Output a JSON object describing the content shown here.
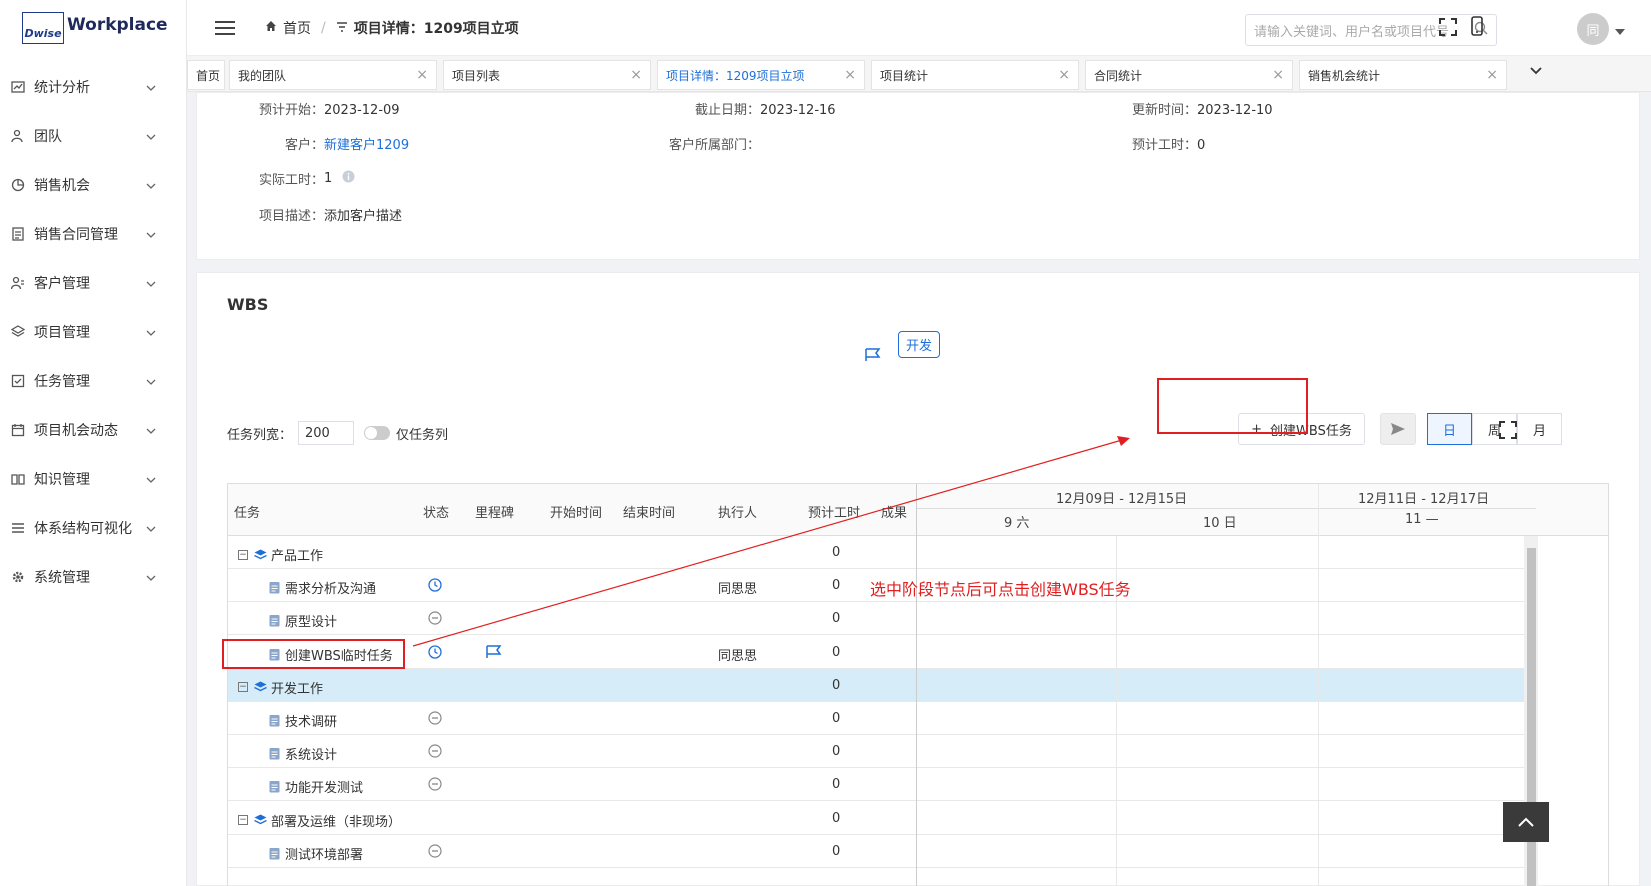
{
  "logo": {
    "mark": "Dwise",
    "text": "Workplace"
  },
  "sidebar": {
    "items": [
      {
        "label": "统计分析",
        "icon": "chart-icon"
      },
      {
        "label": "团队",
        "icon": "team-icon"
      },
      {
        "label": "销售机会",
        "icon": "pie-icon"
      },
      {
        "label": "销售合同管理",
        "icon": "contract-icon"
      },
      {
        "label": "客户管理",
        "icon": "customer-icon"
      },
      {
        "label": "项目管理",
        "icon": "layers-icon"
      },
      {
        "label": "任务管理",
        "icon": "task-icon"
      },
      {
        "label": "项目机会动态",
        "icon": "calendar-icon"
      },
      {
        "label": "知识管理",
        "icon": "book-icon"
      },
      {
        "label": "体系结构可视化",
        "icon": "list-icon"
      },
      {
        "label": "系统管理",
        "icon": "gear-icon"
      }
    ]
  },
  "header": {
    "crumb_home": "首页",
    "crumb_current": "项目详情：1209项目立项",
    "search_placeholder": "请输入关键词、用户名或项目代号",
    "avatar": "同"
  },
  "tabs": [
    {
      "label": "首页"
    },
    {
      "label": "我的团队"
    },
    {
      "label": "项目列表"
    },
    {
      "label": "项目详情：1209项目立项"
    },
    {
      "label": "项目统计"
    },
    {
      "label": "合同统计"
    },
    {
      "label": "销售机会统计"
    }
  ],
  "info": {
    "plan_start_k": "预计开始：",
    "plan_start_v": "2023-12-09",
    "deadline_k": "截止日期：",
    "deadline_v": "2023-12-16",
    "updated_k": "更新时间：",
    "updated_v": "2023-12-10",
    "customer_k": "客户：",
    "customer_v": "新建客户1209",
    "cust_dept_k": "客户所属部门：",
    "est_hours_k": "预计工时：",
    "est_hours_v": "0",
    "actual_hours_k": "实际工时：",
    "actual_hours_v": "1",
    "desc_k": "项目描述：",
    "desc_v": "添加客户描述"
  },
  "wbs": {
    "title": "WBS",
    "milestone": "开发",
    "col_width_label": "任务列宽：",
    "col_width_value": "200",
    "only_tasks": "仅任务列",
    "create_btn": "创建WBS任务",
    "view_day": "日",
    "view_week": "周",
    "view_month": "月",
    "columns": {
      "task": "任务",
      "status": "状态",
      "milestone": "里程碑",
      "start": "开始时间",
      "end": "结束时间",
      "owner": "执行人",
      "est": "预计工时",
      "result": "成果"
    },
    "timeline": {
      "week1": "12月09日 - 12月15日",
      "week2": "12月11日 - 12月17日",
      "d1": "9 六",
      "d2": "10 日",
      "d3": "11 —"
    },
    "rows": [
      {
        "name": "产品工作",
        "level": 0,
        "est": "0"
      },
      {
        "name": "需求分析及沟通",
        "level": 1,
        "status": "clock",
        "owner": "同思思",
        "est": "0"
      },
      {
        "name": "原型设计",
        "level": 1,
        "status": "minus",
        "est": "0"
      },
      {
        "name": "创建WBS临时任务",
        "level": 1,
        "status": "clock",
        "flag": true,
        "owner": "同思思",
        "est": "0"
      },
      {
        "name": "开发工作",
        "level": 0,
        "est": "0",
        "selected": true
      },
      {
        "name": "技术调研",
        "level": 1,
        "status": "minus",
        "est": "0"
      },
      {
        "name": "系统设计",
        "level": 1,
        "status": "minus",
        "est": "0"
      },
      {
        "name": "功能开发测试",
        "level": 1,
        "status": "minus",
        "est": "0"
      },
      {
        "name": "部署及运维（非现场）",
        "level": 0,
        "est": "0"
      },
      {
        "name": "测试环境部署",
        "level": 1,
        "status": "minus",
        "est": "0"
      }
    ],
    "annotation": "选中阶段节点后可点击创建WBS任务"
  },
  "colors": {
    "accent": "#1e6fd9",
    "annotation": "#e02020",
    "selected_row": "#d6ecf8"
  }
}
